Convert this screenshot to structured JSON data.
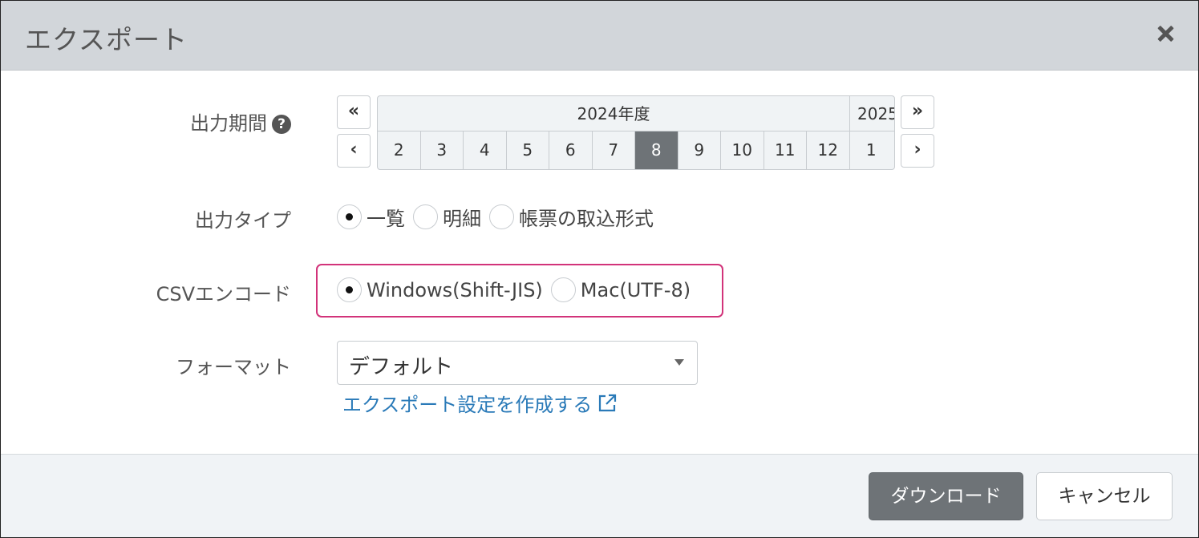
{
  "dialog": {
    "title": "エクスポート"
  },
  "period": {
    "label": "出力期間",
    "prev_year_label": "«",
    "next_year_label": "»",
    "prev_month_label": "‹",
    "next_month_label": "›",
    "year_current": "2024年度",
    "year_next": "2025",
    "months": [
      "2",
      "3",
      "4",
      "5",
      "6",
      "7",
      "8",
      "9",
      "10",
      "11",
      "12",
      "1"
    ],
    "selected_month": "8"
  },
  "output_type": {
    "label": "出力タイプ",
    "options": [
      "一覧",
      "明細",
      "帳票の取込形式"
    ],
    "selected": "一覧"
  },
  "csv_encode": {
    "label": "CSVエンコード",
    "options": [
      "Windows(Shift-JIS)",
      "Mac(UTF-8)"
    ],
    "selected": "Windows(Shift-JIS)",
    "highlight_color": "#d2337a"
  },
  "format": {
    "label": "フォーマット",
    "value": "デフォルト",
    "create_link": "エクスポート設定を作成する"
  },
  "footer": {
    "download_label": "ダウンロード",
    "cancel_label": "キャンセル"
  }
}
